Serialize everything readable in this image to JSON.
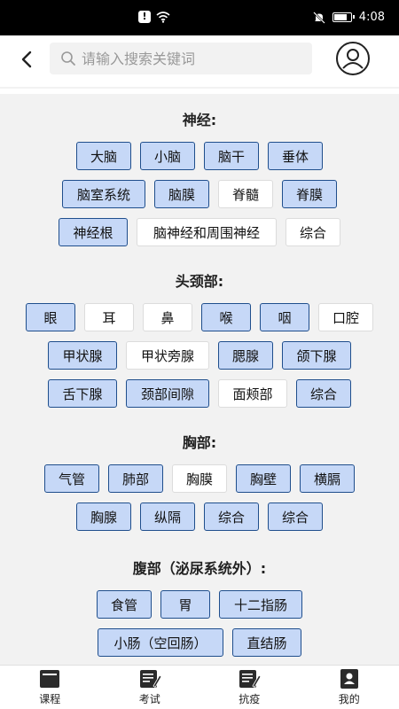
{
  "status": {
    "alert_symbol": "!",
    "time": "4:08"
  },
  "header": {
    "search_placeholder": "请输入搜索关键词"
  },
  "sections": [
    {
      "title": "神经:",
      "rows": [
        [
          {
            "label": "大脑",
            "selected": true
          },
          {
            "label": "小脑",
            "selected": true
          },
          {
            "label": "脑干",
            "selected": true
          },
          {
            "label": "垂体",
            "selected": true
          }
        ],
        [
          {
            "label": "脑室系统",
            "selected": true
          },
          {
            "label": "脑膜",
            "selected": true
          },
          {
            "label": "脊髓",
            "selected": false
          },
          {
            "label": "脊膜",
            "selected": true
          }
        ],
        [
          {
            "label": "神经根",
            "selected": true
          },
          {
            "label": "脑神经和周围神经",
            "selected": false
          },
          {
            "label": "综合",
            "selected": false
          }
        ]
      ]
    },
    {
      "title": "头颈部:",
      "rows": [
        [
          {
            "label": "眼",
            "selected": true
          },
          {
            "label": "耳",
            "selected": false
          },
          {
            "label": "鼻",
            "selected": false
          },
          {
            "label": "喉",
            "selected": true
          },
          {
            "label": "咽",
            "selected": true
          },
          {
            "label": "口腔",
            "selected": false
          }
        ],
        [
          {
            "label": "甲状腺",
            "selected": true
          },
          {
            "label": "甲状旁腺",
            "selected": false
          },
          {
            "label": "腮腺",
            "selected": true
          },
          {
            "label": "颌下腺",
            "selected": true
          }
        ],
        [
          {
            "label": "舌下腺",
            "selected": true
          },
          {
            "label": "颈部间隙",
            "selected": true
          },
          {
            "label": "面颊部",
            "selected": false
          },
          {
            "label": "综合",
            "selected": true
          }
        ]
      ]
    },
    {
      "title": "胸部:",
      "rows": [
        [
          {
            "label": "气管",
            "selected": true
          },
          {
            "label": "肺部",
            "selected": true
          },
          {
            "label": "胸膜",
            "selected": false
          },
          {
            "label": "胸壁",
            "selected": true
          },
          {
            "label": "横膈",
            "selected": true
          }
        ],
        [
          {
            "label": "胸腺",
            "selected": true
          },
          {
            "label": "纵隔",
            "selected": true
          },
          {
            "label": "综合",
            "selected": true
          },
          {
            "label": "综合",
            "selected": true
          }
        ]
      ]
    },
    {
      "title": "腹部（泌尿系统外）:",
      "rows": [
        [
          {
            "label": "食管",
            "selected": true
          },
          {
            "label": "胃",
            "selected": true
          },
          {
            "label": "十二指肠",
            "selected": true
          }
        ],
        [
          {
            "label": "小肠（空回肠）",
            "selected": true
          },
          {
            "label": "直结肠",
            "selected": true
          }
        ]
      ]
    }
  ],
  "bottom_nav": [
    {
      "label": "课程",
      "icon": "course-icon"
    },
    {
      "label": "考试",
      "icon": "exam-icon"
    },
    {
      "label": "抗疫",
      "icon": "antiepidemic-icon"
    },
    {
      "label": "我的",
      "icon": "profile-icon"
    }
  ],
  "colors": {
    "selected_bg": "#c6d8f7",
    "selected_border": "#1f4e8c",
    "unselected_bg": "#ffffff"
  }
}
